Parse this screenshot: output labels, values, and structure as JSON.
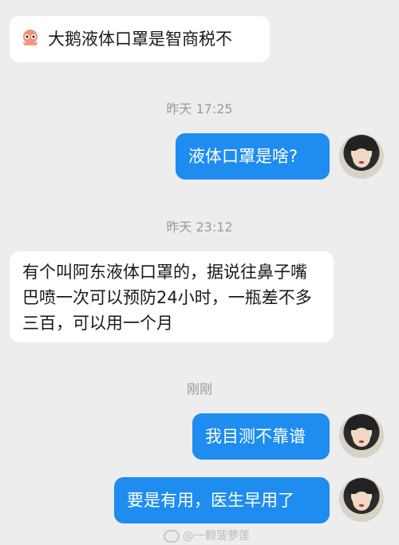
{
  "messages": [
    {
      "text": "大鹅液体口罩是智商税不",
      "side": "left"
    },
    {
      "text": "液体口罩是啥?",
      "side": "right"
    },
    {
      "text": "有个叫阿东液体口罩的，据说往鼻子嘴巴喷一次可以预防24小时，一瓶差不多三百，可以用一个月",
      "side": "left"
    },
    {
      "text": "我目测不靠谱",
      "side": "right"
    },
    {
      "text": "要是有用，医生早用了",
      "side": "right"
    }
  ],
  "timestamps": {
    "t1": "昨天 17:25",
    "t2": "昨天 23:12",
    "t3": "刚刚"
  },
  "watermark": "@一颗菠萝莲",
  "icons": {
    "sender_badge": "octopus-emoji-icon",
    "user_avatar": "user-avatar-portrait"
  },
  "colors": {
    "background": "#ededed",
    "incoming_bubble": "#ffffff",
    "outgoing_bubble": "#1f8cf0",
    "timestamp": "#9a9a9a"
  }
}
